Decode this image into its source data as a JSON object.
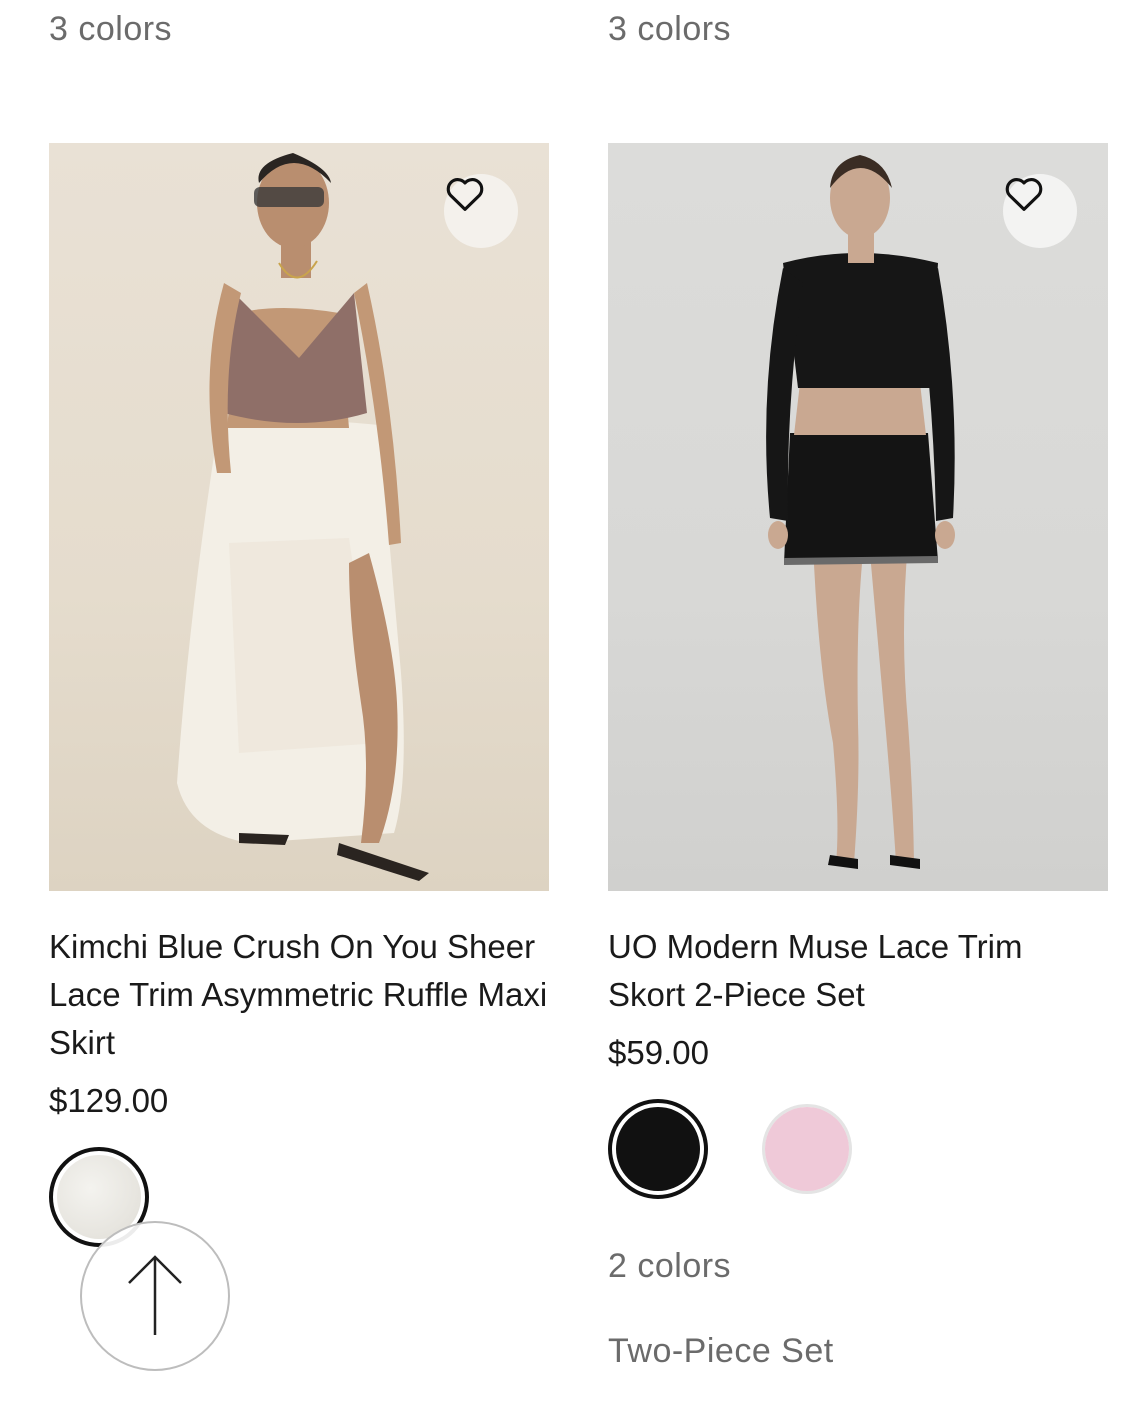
{
  "top_row": {
    "left_colors": "3 colors",
    "right_colors": "3 colors"
  },
  "products": [
    {
      "title": "Kimchi Blue Crush On You Sheer Lace Trim Asymmetric Ruffle Maxi Skirt",
      "price": "$129.00",
      "swatches": [
        {
          "name": "ivory",
          "color": "#ebe9e4",
          "selected": true
        }
      ]
    },
    {
      "title": "UO Modern Muse Lace Trim Skort 2-Piece Set",
      "price": "$59.00",
      "swatches": [
        {
          "name": "black",
          "color": "#111111",
          "selected": true
        },
        {
          "name": "pink",
          "color": "#efc9d8",
          "selected": false
        }
      ],
      "color_count": "2 colors",
      "category": "Two-Piece Set"
    }
  ],
  "icons": {
    "favorite": "heart-outline-icon",
    "scroll_top": "arrow-up-icon"
  }
}
